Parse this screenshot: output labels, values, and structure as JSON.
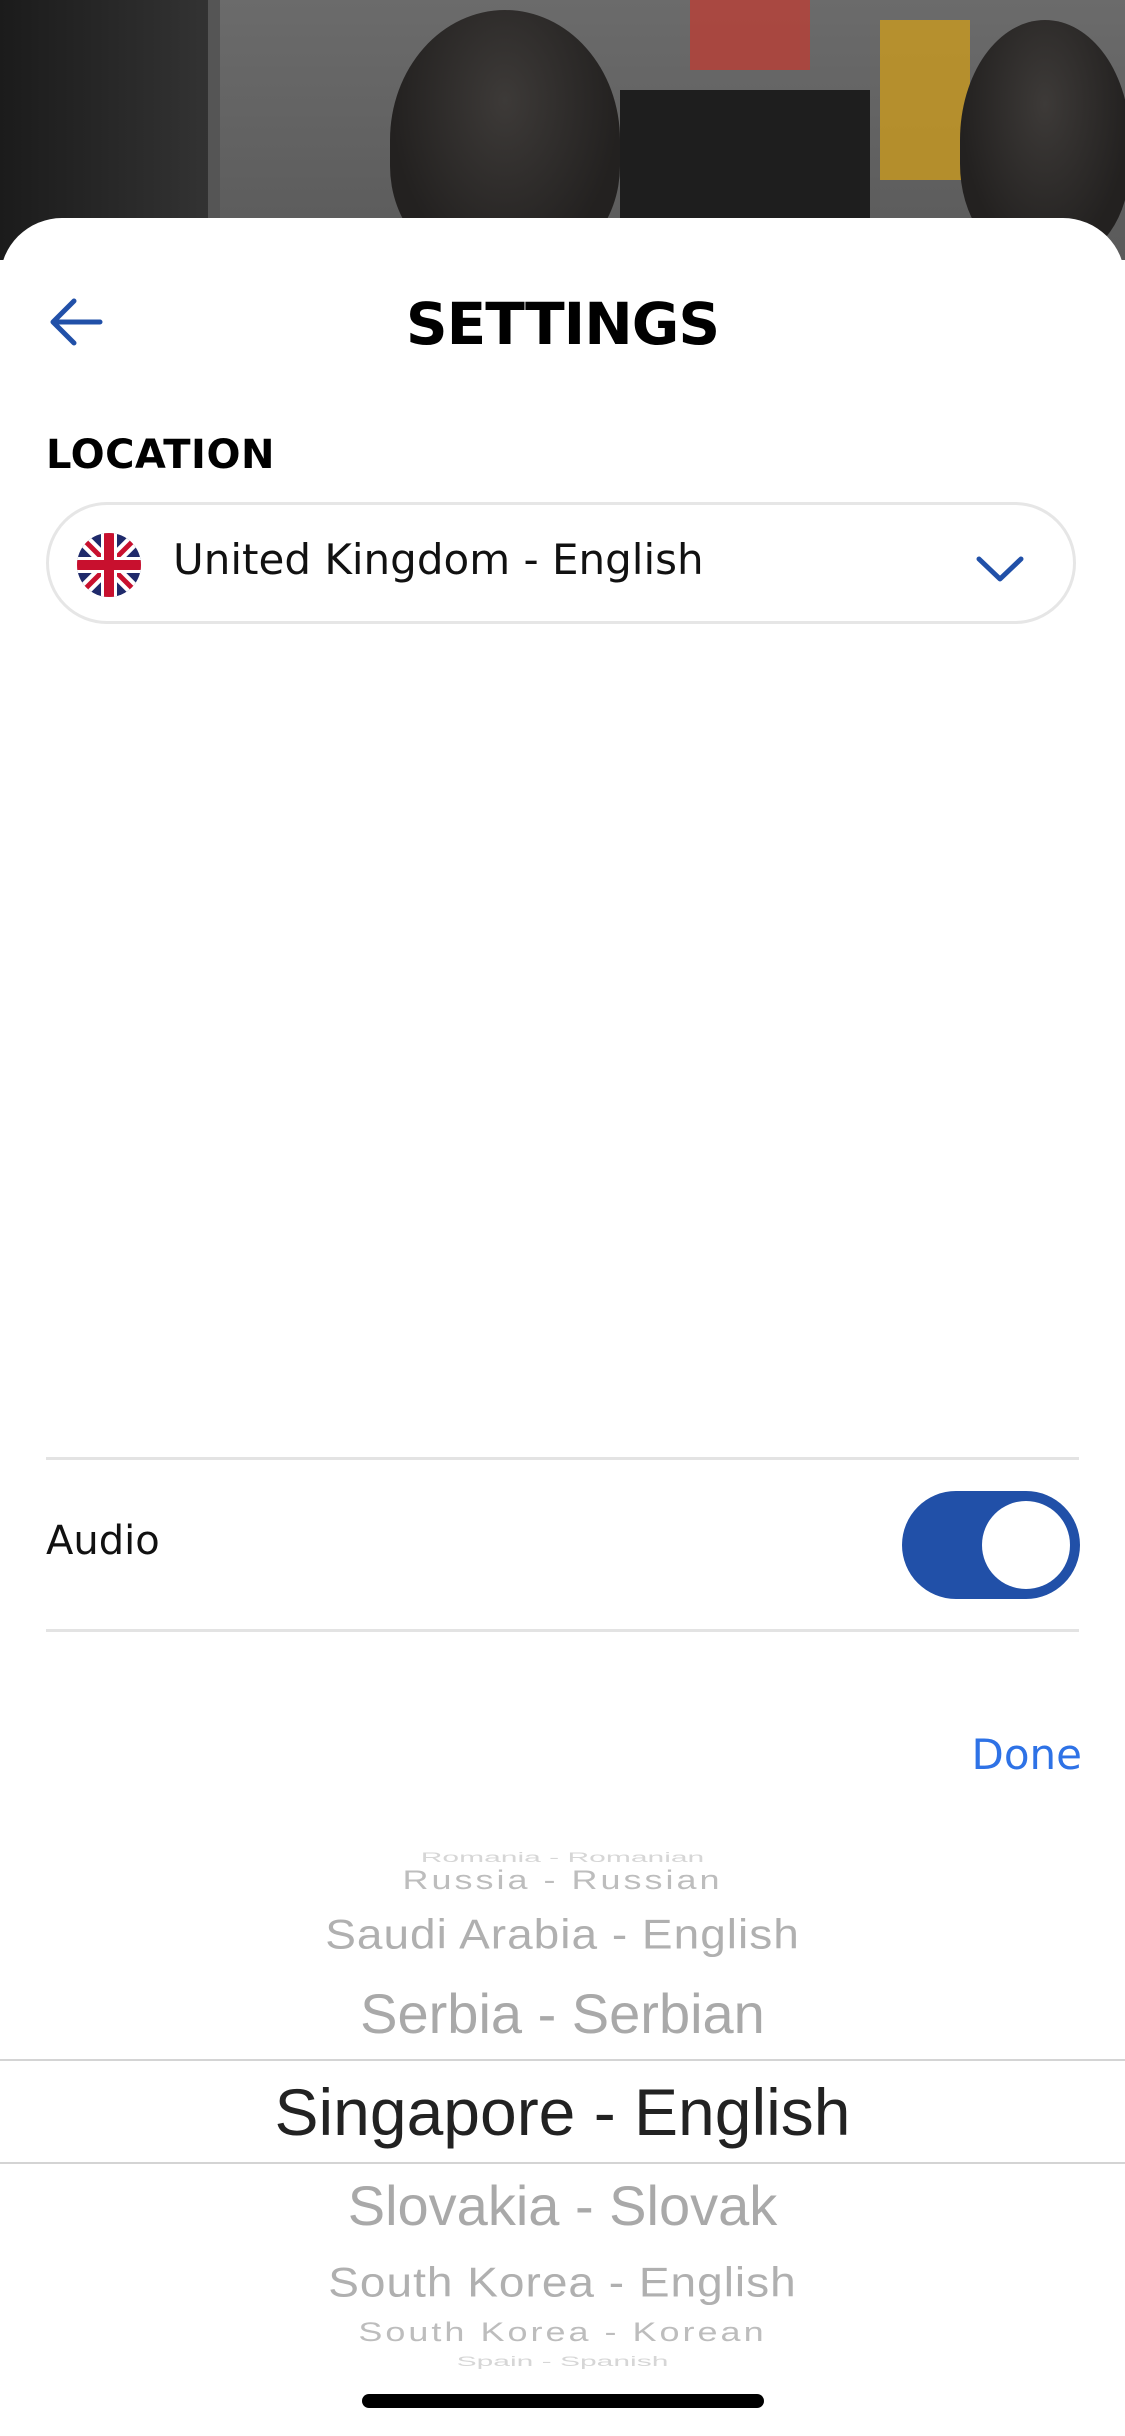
{
  "header": {
    "title": "SETTINGS",
    "back_icon": "arrow-left-icon"
  },
  "location": {
    "label": "LOCATION",
    "selected": "United Kingdom - English",
    "flag_icon": "uk-flag-icon"
  },
  "audio": {
    "label": "Audio",
    "enabled": true
  },
  "picker": {
    "done_label": "Done",
    "items": [
      "Romania - Romanian",
      "Russia - Russian",
      "Saudi Arabia - English",
      "Serbia - Serbian",
      "Singapore - English",
      "Slovakia - Slovak",
      "South Korea - English",
      "South Korea - Korean",
      "Spain - Spanish"
    ],
    "selected": "Singapore - English"
  },
  "colors": {
    "accent": "#2150a8",
    "link": "#2e72e6"
  }
}
